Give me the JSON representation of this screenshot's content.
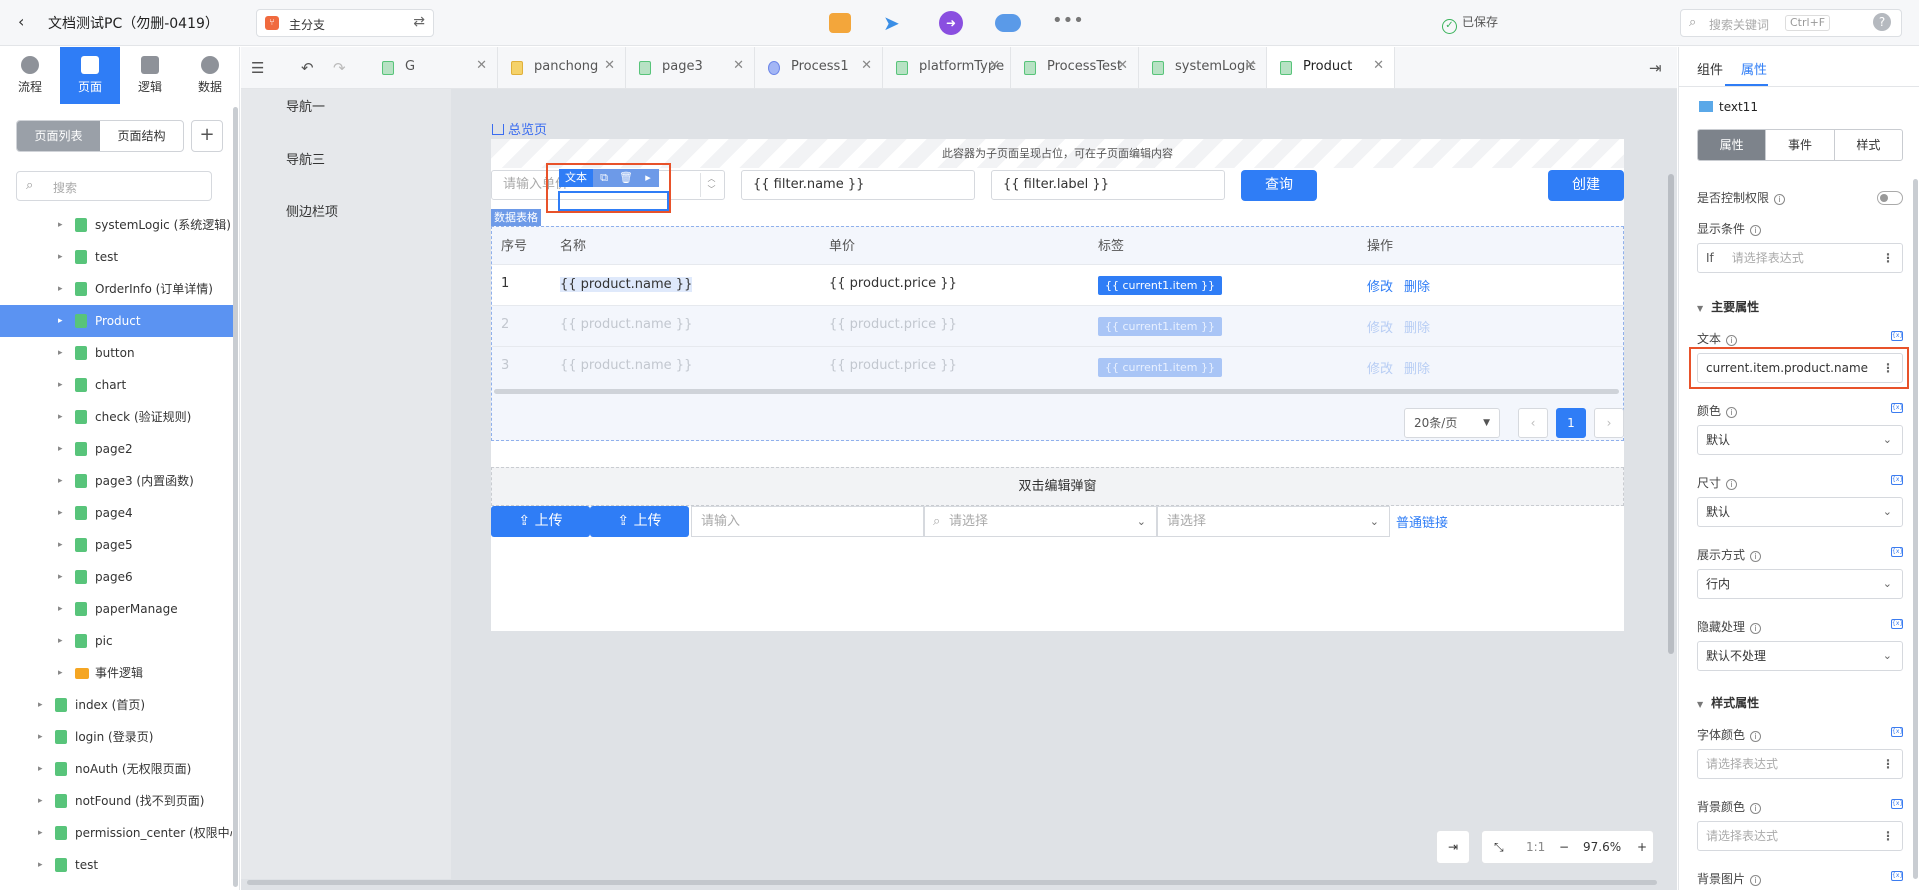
{
  "app": {
    "title": "文档测试PC（勿删-0419）",
    "branch": "主分支",
    "saved": "已保存",
    "search_placeholder": "搜索关键词",
    "search_shortcut": "Ctrl+F"
  },
  "left_tabs": [
    {
      "label": "流程"
    },
    {
      "label": "页面"
    },
    {
      "label": "逻辑"
    },
    {
      "label": "数据"
    }
  ],
  "left_segment": {
    "list": "页面列表",
    "structure": "页面结构"
  },
  "left_search_placeholder": "搜索",
  "tree": [
    {
      "label": "systemLogic (系统逻辑)",
      "level": 2,
      "icon": "page"
    },
    {
      "label": "test",
      "level": 2,
      "icon": "page"
    },
    {
      "label": "OrderInfo (订单详情)",
      "level": 2,
      "icon": "page"
    },
    {
      "label": "Product",
      "level": 2,
      "icon": "page",
      "selected": true
    },
    {
      "label": "button",
      "level": 2,
      "icon": "page"
    },
    {
      "label": "chart",
      "level": 2,
      "icon": "page"
    },
    {
      "label": "check (验证规则)",
      "level": 2,
      "icon": "page"
    },
    {
      "label": "page2",
      "level": 2,
      "icon": "page"
    },
    {
      "label": "page3 (内置函数)",
      "level": 2,
      "icon": "page"
    },
    {
      "label": "page4",
      "level": 2,
      "icon": "page"
    },
    {
      "label": "page5",
      "level": 2,
      "icon": "page"
    },
    {
      "label": "page6",
      "level": 2,
      "icon": "page"
    },
    {
      "label": "paperManage",
      "level": 2,
      "icon": "page"
    },
    {
      "label": "pic",
      "level": 2,
      "icon": "page"
    },
    {
      "label": "事件逻辑",
      "level": 2,
      "icon": "folder"
    },
    {
      "label": "index (首页)",
      "level": 1,
      "icon": "page"
    },
    {
      "label": "login (登录页)",
      "level": 1,
      "icon": "page"
    },
    {
      "label": "noAuth (无权限页面)",
      "level": 1,
      "icon": "page"
    },
    {
      "label": "notFound (找不到页面)",
      "level": 1,
      "icon": "page"
    },
    {
      "label": "permission_center (权限中心)",
      "level": 1,
      "icon": "page"
    },
    {
      "label": "test",
      "level": 1,
      "icon": "page"
    }
  ],
  "file_tabs": [
    {
      "label": "G",
      "icon": "page"
    },
    {
      "label": "panchong",
      "icon": "pan"
    },
    {
      "label": "page3",
      "icon": "page"
    },
    {
      "label": "Process1",
      "icon": "proc"
    },
    {
      "label": "platformType",
      "icon": "page"
    },
    {
      "label": "ProcessTest",
      "icon": "page"
    },
    {
      "label": "systemLogic",
      "icon": "page"
    },
    {
      "label": "Product",
      "icon": "page",
      "active": true
    }
  ],
  "canvas": {
    "nav": [
      "导航一",
      "导航三",
      "侧边栏项"
    ],
    "breadcrumb": "总览页",
    "placeholder_note": "此容器为子页面呈现占位，可在子页面编辑内容",
    "filter_price_placeholder": "请输入单价",
    "filter_name": "{{ filter.name }}",
    "filter_label": "{{ filter.label }}",
    "query_button": "查询",
    "create_button": "创建",
    "table_tag": "数据表格",
    "table_headers": [
      "序号",
      "名称",
      "单价",
      "标签",
      "操作"
    ],
    "rows": [
      {
        "index": "1",
        "name": "{{ product.name }}",
        "price": "{{ product.price }}",
        "tag": "{{ current1.item }}",
        "edit": "修改",
        "delete": "删除"
      },
      {
        "index": "2",
        "name": "{{ product.name }}",
        "price": "{{ product.price }}",
        "tag": "{{ current1.item }}",
        "edit": "修改",
        "delete": "删除"
      },
      {
        "index": "3",
        "name": "{{ product.name }}",
        "price": "{{ product.price }}",
        "tag": "{{ current1.item }}",
        "edit": "修改",
        "delete": "删除"
      }
    ],
    "selection_label": "文本",
    "page_size": "20条/页",
    "current_page": "1",
    "modal_hint": "双击编辑弹窗",
    "upload_label": "上传",
    "input_placeholder": "请输入",
    "select_placeholder": "请选择",
    "link_text": "普通链接",
    "zoom_ratio": "1:1",
    "zoom_level": "97.6%"
  },
  "right": {
    "tabs": [
      "组件",
      "属性"
    ],
    "component_name": "text11",
    "segment": [
      "属性",
      "事件",
      "样式"
    ],
    "permission_label": "是否控制权限",
    "condition_label": "显示条件",
    "condition_prefix": "If",
    "condition_placeholder": "请选择表达式",
    "main_section": "主要属性",
    "text_label": "文本",
    "text_value": "current.item.product.name",
    "color_label": "颜色",
    "color_value": "默认",
    "size_label": "尺寸",
    "size_value": "默认",
    "display_label": "展示方式",
    "display_value": "行内",
    "hidden_label": "隐藏处理",
    "hidden_value": "默认不处理",
    "style_section": "样式属性",
    "font_color_label": "字体颜色",
    "font_color_placeholder": "请选择表达式",
    "bg_color_label": "背景颜色",
    "bg_color_placeholder": "请选择表达式",
    "bg_image_label": "背景图片"
  },
  "colors": {
    "accent": "#2f7df6",
    "highlight": "#e8522a",
    "selected_tree": "#5b93f2"
  }
}
